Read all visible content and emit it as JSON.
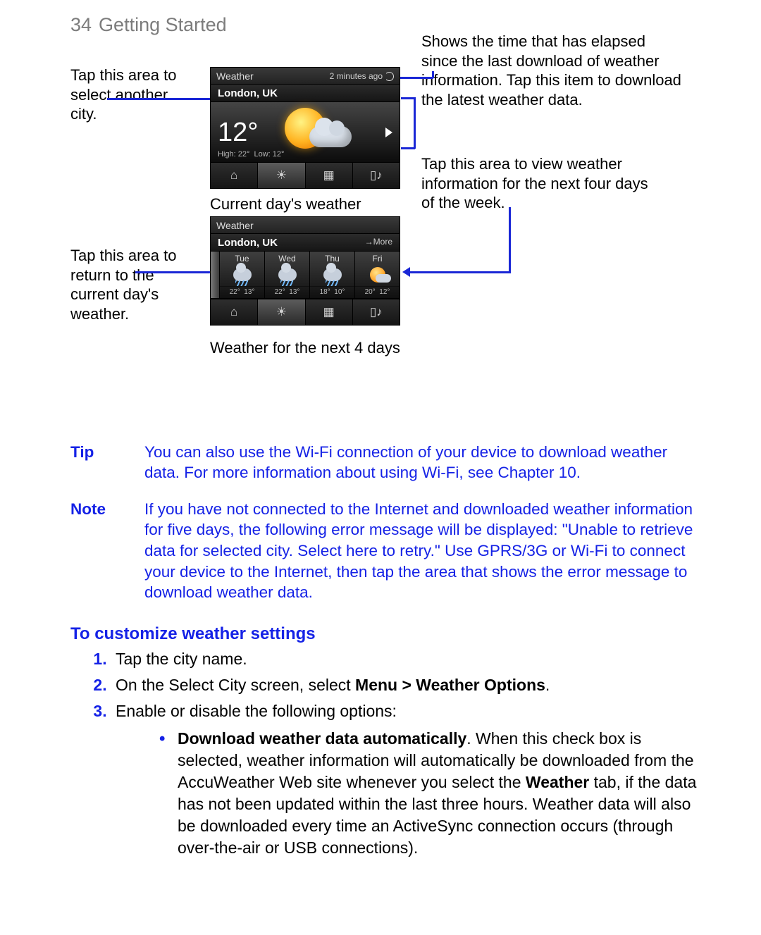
{
  "page": {
    "number": "34",
    "section": "Getting Started"
  },
  "callouts": {
    "selectCity": "Tap this area to select another city.",
    "elapsed": "Shows the time that has elapsed since the last download of weather information. Tap this item to download the latest weather data.",
    "next4": "Tap this area to view weather information for the next four days of the week.",
    "returnCurrent": "Tap this area to return to the current day's weather."
  },
  "captions": {
    "shot1": "Current day's weather",
    "shot2": "Weather for the next 4 days"
  },
  "shot1": {
    "title": "Weather",
    "elapsed": "2 minutes ago",
    "city": "London, UK",
    "temp": "12°",
    "high": "High: 22°",
    "low": "Low: 12°"
  },
  "shot2": {
    "title": "Weather",
    "city": "London, UK",
    "more": "→More",
    "days": [
      {
        "name": "Tue",
        "icon": "rain",
        "hi": "22°",
        "lo": "13°"
      },
      {
        "name": "Wed",
        "icon": "rain",
        "hi": "22°",
        "lo": "13°"
      },
      {
        "name": "Thu",
        "icon": "rain",
        "hi": "18°",
        "lo": "10°"
      },
      {
        "name": "Fri",
        "icon": "sunny",
        "hi": "20°",
        "lo": "12°"
      }
    ]
  },
  "tip": {
    "label": "Tip",
    "text": "You can also use the Wi-Fi connection of your device to download weather data. For more information about using Wi-Fi, see Chapter 10."
  },
  "note": {
    "label": "Note",
    "text": "If you have not connected to the Internet and downloaded weather information for five days, the following error message will be displayed: \"Unable to retrieve data for selected city. Select here to retry.\" Use GPRS/3G or Wi-Fi to connect your device to the Internet, then tap the area that shows the error message to download weather data."
  },
  "section_heading": "To customize weather settings",
  "steps": {
    "s1": "Tap the city name.",
    "s2a": "On the Select City screen, select ",
    "s2b": "Menu > Weather Options",
    "s2c": ".",
    "s3": "Enable or disable the following options:"
  },
  "bullet": {
    "b1_bold1": "Download weather data automatically",
    "b1_mid": ". When this check box is selected, weather information will automatically be downloaded from the AccuWeather Web site whenever you select the ",
    "b1_bold2": "Weather",
    "b1_end": " tab, if the data has not been updated within the last three hours. Weather data will also be downloaded every time an ActiveSync connection occurs (through over-the-air or USB connections)."
  }
}
